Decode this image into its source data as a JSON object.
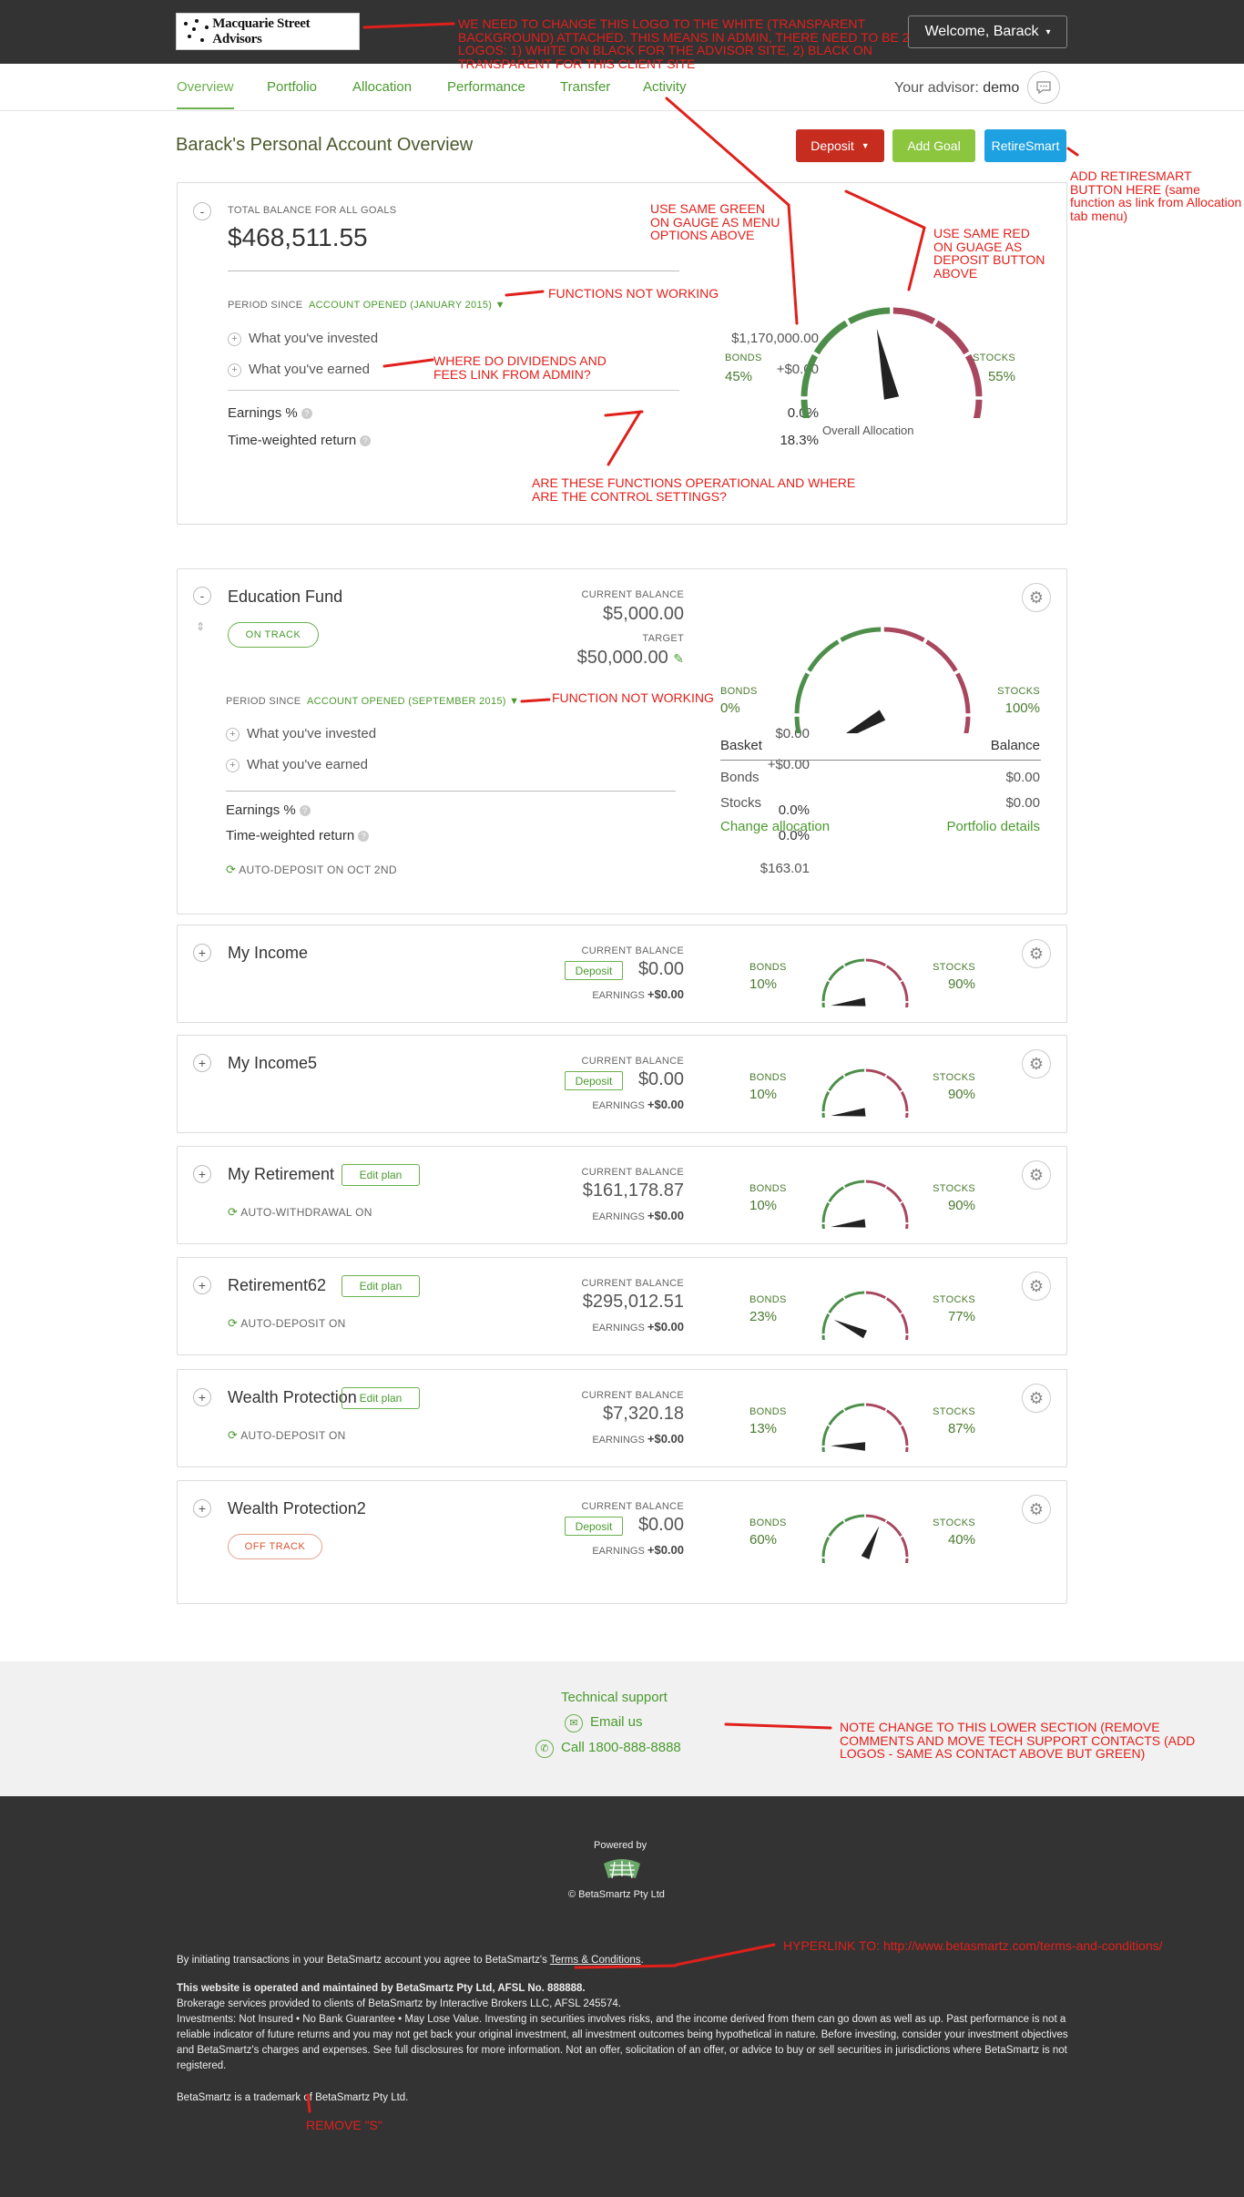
{
  "header": {
    "logo_text": "Macquarie Street Advisors",
    "welcome": "Welcome, Barack",
    "caret": "▾"
  },
  "nav": {
    "tabs": [
      "Overview",
      "Portfolio",
      "Allocation",
      "Performance",
      "Transfer",
      "Activity"
    ],
    "advisor_label": "Your advisor:",
    "advisor_name": "demo"
  },
  "page": {
    "title": "Barack's Personal Account Overview",
    "actions": {
      "deposit": "Deposit",
      "add_goal": "Add Goal",
      "retiresmart": "RetireSmart"
    }
  },
  "overview": {
    "toggle": "-",
    "total_label": "TOTAL BALANCE FOR ALL GOALS",
    "total": "$468,511.55",
    "period_label": "PERIOD SINCE",
    "period_value": "ACCOUNT OPENED (JANUARY 2015)",
    "invested_label": "What you've invested",
    "invested": "$1,170,000.00",
    "earned_label": "What you've earned",
    "earned": "+$0.00",
    "earnings_pct_label": "Earnings %",
    "earnings_pct": "0.0%",
    "twr_label": "Time-weighted return",
    "twr": "18.3%",
    "bonds_label": "BONDS",
    "bonds": "45%",
    "stocks_label": "STOCKS",
    "stocks": "55%",
    "gauge_caption": "Overall Allocation",
    "bonds_fraction": 0.45
  },
  "education": {
    "toggle": "-",
    "name": "Education Fund",
    "status": "ON TRACK",
    "current_label": "CURRENT BALANCE",
    "current": "$5,000.00",
    "target_label": "TARGET",
    "target": "$50,000.00",
    "period_label": "PERIOD SINCE",
    "period_value": "ACCOUNT OPENED (SEPTEMBER 2015)",
    "invested_label": "What you've invested",
    "invested": "$0.00",
    "earned_label": "What you've earned",
    "earned": "+$0.00",
    "earnings_pct_label": "Earnings %",
    "earnings_pct": "0.0%",
    "twr_label": "Time-weighted return",
    "twr": "0.0%",
    "auto_label": "AUTO-DEPOSIT ON OCT 2ND",
    "auto_value": "$163.01",
    "bonds_label": "BONDS",
    "bonds": "0%",
    "stocks_label": "STOCKS",
    "stocks": "100%",
    "bonds_fraction": 0.0,
    "table_header": [
      "Basket",
      "Balance"
    ],
    "rows": [
      [
        "Bonds",
        "$0.00"
      ],
      [
        "Stocks",
        "$0.00"
      ]
    ],
    "change_allocation": "Change allocation",
    "portfolio_details": "Portfolio details"
  },
  "goals": [
    {
      "name": "My Income",
      "badge": "Deposit",
      "badge_type": "deposit",
      "sub": "",
      "current_label": "CURRENT BALANCE",
      "current": "$0.00",
      "earnings_label": "EARNINGS",
      "earnings": "+$0.00",
      "bonds": "10%",
      "stocks": "90%",
      "bonds_fraction": 0.1
    },
    {
      "name": "My Income5",
      "badge": "Deposit",
      "badge_type": "deposit",
      "sub": "",
      "current_label": "CURRENT BALANCE",
      "current": "$0.00",
      "earnings_label": "EARNINGS",
      "earnings": "+$0.00",
      "bonds": "10%",
      "stocks": "90%",
      "bonds_fraction": 0.1
    },
    {
      "name": "My Retirement",
      "badge": "Edit plan",
      "badge_type": "edit",
      "sub": "AUTO-WITHDRAWAL ON",
      "current_label": "CURRENT BALANCE",
      "current": "$161,178.87",
      "earnings_label": "EARNINGS",
      "earnings": "+$0.00",
      "bonds": "10%",
      "stocks": "90%",
      "bonds_fraction": 0.1
    },
    {
      "name": "Retirement62",
      "badge": "Edit plan",
      "badge_type": "edit",
      "sub": "AUTO-DEPOSIT ON",
      "current_label": "CURRENT BALANCE",
      "current": "$295,012.51",
      "earnings_label": "EARNINGS",
      "earnings": "+$0.00",
      "bonds": "23%",
      "stocks": "77%",
      "bonds_fraction": 0.23
    },
    {
      "name": "Wealth Protection",
      "badge": "Edit plan",
      "badge_type": "edit",
      "sub": "AUTO-DEPOSIT ON",
      "current_label": "CURRENT BALANCE",
      "current": "$7,320.18",
      "earnings_label": "EARNINGS",
      "earnings": "+$0.00",
      "bonds": "13%",
      "stocks": "87%",
      "bonds_fraction": 0.13
    },
    {
      "name": "Wealth Protection2",
      "badge": "Deposit",
      "badge_type": "deposit",
      "sub": "OFF TRACK",
      "current_label": "CURRENT BALANCE",
      "current": "$0.00",
      "earnings_label": "EARNINGS",
      "earnings": "+$0.00",
      "bonds": "60%",
      "stocks": "40%",
      "bonds_fraction": 0.6
    }
  ],
  "goal_labels": {
    "bonds": "BONDS",
    "stocks": "STOCKS",
    "toggle": "+"
  },
  "support": {
    "title": "Technical support",
    "email": "Email us",
    "phone": "Call 1800-888-8888"
  },
  "footer": {
    "powered_by": "Powered by",
    "copyright": "© BetaSmartz Pty Ltd",
    "agree_prefix": "By initiating transactions in your BetaSmartz account you agree to BetaSmartz's",
    "terms_link": "Terms & Conditions",
    "agree_suffix": ".",
    "operated": "This website is operated and maintained by BetaSmartz Pty Ltd, AFSL No. 888888.",
    "brokerage": "Brokerage services provided to clients of BetaSmartz by Interactive Brokers LLC, AFSL 245574.",
    "disclaimer": "Investments: Not Insured • No Bank Guarantee • May Lose Value. Investing in securities involves risks, and the income derived from them can go down as well as up. Past performance is not a reliable indicator of future returns and you may not get back your original investment, all investment outcomes being hypothetical in nature. Before investing, consider your investment objectives and BetaSmartz's charges and expenses. See full disclosures for more information. Not an offer, solicitation of an offer, or advice to buy or sell securities in jurisdictions where BetaSmartz is not registered.",
    "trademark": "BetaSmartz is a trademark of BetaSmartz Pty Ltd."
  },
  "annotations": {
    "logo": "WE NEED TO CHANGE THIS LOGO TO THE WHITE (TRANSPARENT BACKGROUND) ATTACHED. THIS MEANS IN ADMIN, THERE NEED TO BE 2 LOGOS: 1) WHITE ON BLACK FOR THE ADVISOR SITE, 2) BLACK ON TRANSPARENT FOR THIS CLIENT SITE",
    "retiresmart": "ADD RETIRESMART BUTTON HERE (same function as link from Allocation tab menu)",
    "green": "USE SAME GREEN ON GAUGE AS MENU OPTIONS ABOVE",
    "red": "USE SAME RED ON GUAGE AS DEPOSIT BUTTON ABOVE",
    "functions": "FUNCTIONS NOT WORKING",
    "dividends": "WHERE DO DIVIDENDS AND FEES LINK FROM ADMIN?",
    "operational": "ARE THESE FUNCTIONS OPERATIONAL AND WHERE ARE THE CONTROL SETTINGS?",
    "function": "FUNCTION NOT WORKING",
    "lower": "NOTE CHANGE TO THIS LOWER SECTION (REMOVE COMMENTS AND MOVE TECH SUPPORT CONTACTS (ADD LOGOS - SAME AS CONTACT ABOVE BUT GREEN)",
    "hyperlink": "HYPERLINK TO: http://www.betasmartz.com/terms-and-conditions/",
    "remove": "REMOVE \"S\""
  },
  "colors": {
    "gauge_green": "#4d8f4a",
    "gauge_red": "#a8475e",
    "accent_green": "#4a9a2e",
    "annotation_red": "#e0201b"
  }
}
